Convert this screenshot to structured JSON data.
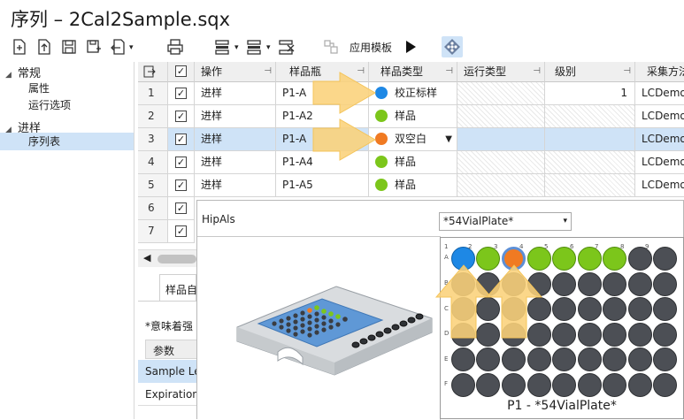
{
  "window": {
    "title": "序列 – 2Cal2Sample.sqx"
  },
  "toolbar": {
    "apply_template": "应用模板"
  },
  "nav": {
    "groups": [
      {
        "label": "常规",
        "items": [
          "属性",
          "运行选项"
        ]
      },
      {
        "label": "进样",
        "items": [
          "序列表"
        ]
      }
    ]
  },
  "grid": {
    "headers": [
      "操作",
      "样品瓶",
      "样品类型",
      "运行类型",
      "级别",
      "采集方法"
    ],
    "rows": [
      {
        "num": "1",
        "action": "进样",
        "vial": "P1-A",
        "type": "校正标样",
        "type_color": "#1e88e5",
        "level": "1",
        "method": "LCDemo."
      },
      {
        "num": "2",
        "action": "进样",
        "vial": "P1-A2",
        "type": "样品",
        "type_color": "#7cc61b",
        "level": "",
        "method": "LCDemo."
      },
      {
        "num": "3",
        "action": "进样",
        "vial": "P1-A",
        "type": "双空白",
        "type_color": "#f07a22",
        "level": "",
        "method": "LCDemo."
      },
      {
        "num": "4",
        "action": "进样",
        "vial": "P1-A4",
        "type": "样品",
        "type_color": "#7cc61b",
        "level": "",
        "method": "LCDemo."
      },
      {
        "num": "5",
        "action": "进样",
        "vial": "P1-A5",
        "type": "样品",
        "type_color": "#7cc61b",
        "level": "",
        "method": "LCDemo."
      },
      {
        "num": "6"
      },
      {
        "num": "7"
      }
    ]
  },
  "lower": {
    "tab": "样品自",
    "note": "*意味着强",
    "param_header": "参数",
    "param_rows": [
      "Sample Le",
      "Expiration"
    ]
  },
  "popup": {
    "title": "HipAls",
    "plate_selector": "*54VialPlate*",
    "plate_caption": "P1 - *54VialPlate*",
    "col_labels": [
      "1",
      "2",
      "3",
      "4",
      "5",
      "6",
      "7",
      "8",
      "9"
    ],
    "row_labels": [
      "A",
      "B",
      "C",
      "D",
      "E",
      "F"
    ]
  },
  "colors": {
    "calibration": "#1e88e5",
    "sample": "#7cc61b",
    "double_blank": "#f07a22",
    "empty_well": "#4c4f55",
    "selection": "#cfe3f7",
    "arrow": "#fbd27a"
  }
}
